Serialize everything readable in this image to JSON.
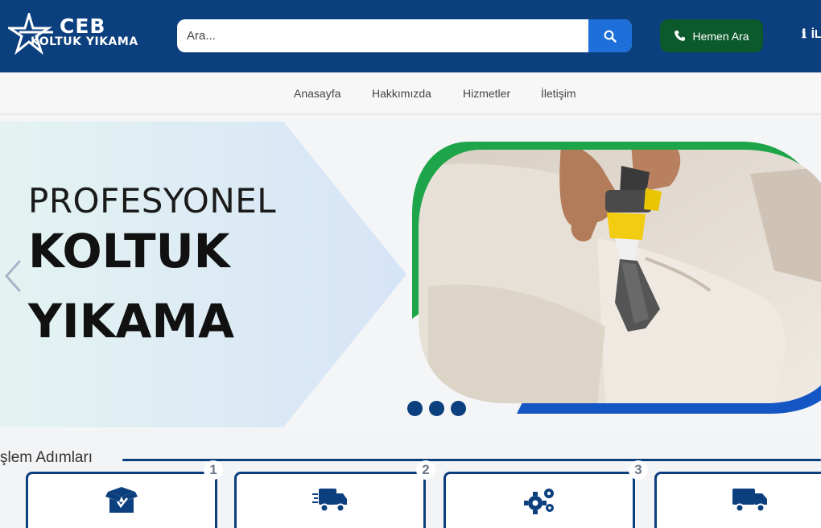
{
  "brand": {
    "name_line1": "CEB",
    "name_line2": "KOLTUK YIKAMA",
    "primary_color": "#0b3f7d",
    "accent_green": "#0c5a2c",
    "search_blue": "#1e6fd9"
  },
  "header": {
    "search_placeholder": "Ara...",
    "call_label": "Hemen Ara",
    "info_label": "İL"
  },
  "nav": {
    "items": [
      "Anasayfa",
      "Hakkımızda",
      "Hizmetler",
      "İletişim"
    ]
  },
  "hero": {
    "line1": "PROFESYONEL",
    "line2": "KOLTUK",
    "line3": "YIKAMA",
    "slide_count": 3
  },
  "steps": {
    "title": "şlem Adımları",
    "items": [
      {
        "number": "",
        "icon": "box-icon"
      },
      {
        "number": "1",
        "icon": "delivery-truck-icon"
      },
      {
        "number": "2",
        "icon": "gears-icon"
      },
      {
        "number": "3",
        "icon": "truck-icon"
      }
    ]
  }
}
